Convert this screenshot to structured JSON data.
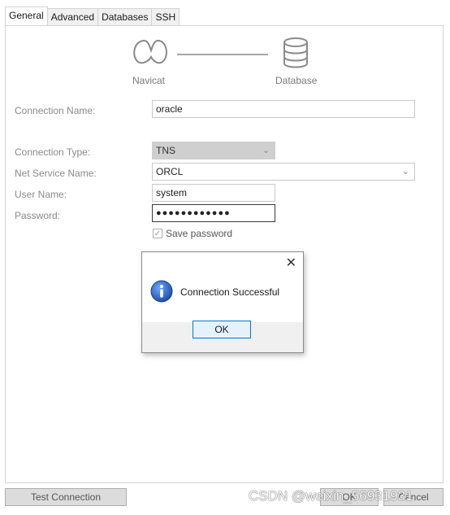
{
  "tabs": [
    "General",
    "Advanced",
    "Databases",
    "SSH"
  ],
  "diagram": {
    "left_label": "Navicat",
    "right_label": "Database",
    "left_icon": "navicat-icon",
    "right_icon": "database-icon"
  },
  "form": {
    "connection_name": {
      "label": "Connection Name:",
      "value": "oracle"
    },
    "connection_type": {
      "label": "Connection Type:",
      "value": "TNS"
    },
    "net_service_name": {
      "label": "Net Service Name:",
      "value": "ORCL"
    },
    "user_name": {
      "label": "User Name:",
      "value": "system"
    },
    "password": {
      "label": "Password:",
      "value": "●●●●●●●●●●●●"
    },
    "save_password": {
      "label": "Save password",
      "checked": true
    }
  },
  "dialog": {
    "message": "Connection Successful",
    "ok_label": "OK",
    "close_glyph": "✕",
    "icon": "info-icon"
  },
  "bottom": {
    "test_connection": "Test Connection",
    "ok_label": "OK",
    "cancel_label": "Cancel"
  },
  "watermark": "CSDN @weixin_56931931",
  "colors": {
    "accent": "#0078d7",
    "info_icon": "#1f5fbf"
  }
}
